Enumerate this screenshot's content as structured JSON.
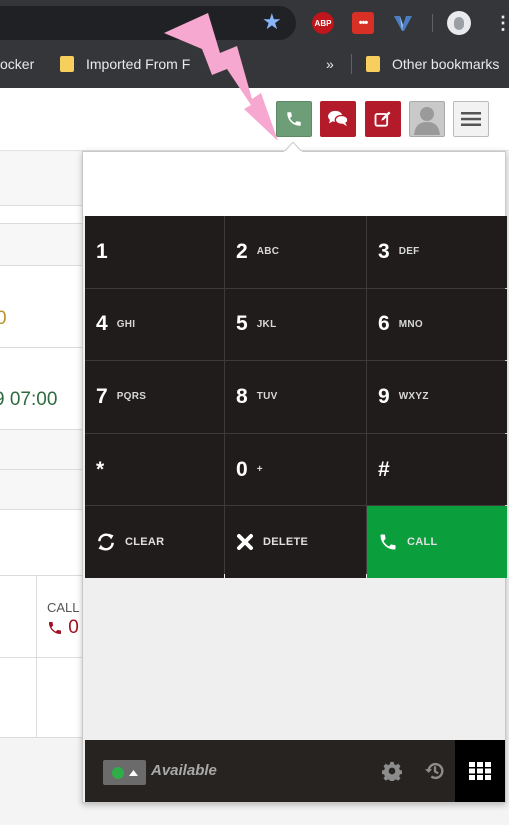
{
  "browser": {
    "bookmarks": {
      "blocker_label": "ocker",
      "imported_label": "Imported From F",
      "chevron": "»",
      "other_label": "Other bookmarks"
    },
    "extensions": {
      "abp_label": "ABP",
      "dots_label": "•••",
      "v_label": "V"
    },
    "star_icon": "star-icon",
    "kebab": "⋮"
  },
  "page": {
    "bg_text_1": "0",
    "bg_time": "9 07:00",
    "bg_call_label": "CALL",
    "bg_call_value": "0"
  },
  "dialer": {
    "display_value": "",
    "keys": [
      {
        "digit": "1",
        "letters": ""
      },
      {
        "digit": "2",
        "letters": "ABC"
      },
      {
        "digit": "3",
        "letters": "DEF"
      },
      {
        "digit": "4",
        "letters": "GHI"
      },
      {
        "digit": "5",
        "letters": "JKL"
      },
      {
        "digit": "6",
        "letters": "MNO"
      },
      {
        "digit": "7",
        "letters": "PQRS"
      },
      {
        "digit": "8",
        "letters": "TUV"
      },
      {
        "digit": "9",
        "letters": "WXYZ"
      },
      {
        "digit": "*",
        "letters": ""
      },
      {
        "digit": "0",
        "letters": "+"
      },
      {
        "digit": "#",
        "letters": ""
      }
    ],
    "clear_label": "CLEAR",
    "delete_label": "DELETE",
    "call_label": "CALL",
    "status_label": "Available"
  },
  "colors": {
    "call_green": "#0a9e3c",
    "header_red": "#b31a2a",
    "phone_green": "#6d9e77",
    "keypad_dark": "#201c1b",
    "available_green": "#2fae47"
  }
}
